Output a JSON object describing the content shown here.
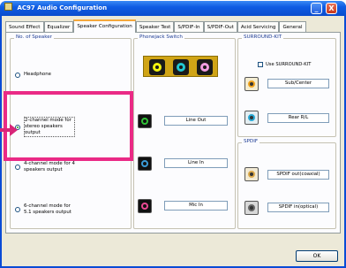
{
  "window": {
    "title": "AC97 Audio Configuration",
    "minimize": "_",
    "close": "X"
  },
  "tabs": [
    "Sound Effect",
    "Equalizer",
    "Speaker Configuration",
    "Speaker Test",
    "S/PDIF-In",
    "S/PDIF-Out",
    "Acid Servicing",
    "General"
  ],
  "speakers": {
    "title": "No. of Speaker",
    "options": [
      {
        "label": "Headphone",
        "selected": false
      },
      {
        "label": "2-channel mode for stereo speakers output",
        "selected": true
      },
      {
        "label": "4-channel mode for 4 speakers output",
        "selected": false
      },
      {
        "label": "6-channel mode for 5.1 speakers output",
        "selected": false
      }
    ]
  },
  "jacks": {
    "title": "Phonejack Switch",
    "colors": [
      "#f4f40f",
      "#22c7d2",
      "#f29de2"
    ],
    "rows": [
      {
        "label": "Line Out",
        "color": "#31c237"
      },
      {
        "label": "Line In",
        "color": "#3b9bd8"
      },
      {
        "label": "Mic In",
        "color": "#ec4a94"
      }
    ]
  },
  "surround": {
    "title": "SURROUND-KIT",
    "checkbox": "Use SURROUND-KIT",
    "rows": [
      {
        "label": "Sub/Center",
        "color": "#f0a21c"
      },
      {
        "label": "Rear R/L",
        "color": "#27a9d6"
      }
    ]
  },
  "spdif": {
    "title": "SPDIF",
    "rows": [
      {
        "label": "SPDIF out(coaxial)",
        "color": "#dca94a"
      },
      {
        "label": "SPDIF in(optical)",
        "color": "#666666"
      }
    ]
  },
  "footer": {
    "ok_label": "OK"
  }
}
